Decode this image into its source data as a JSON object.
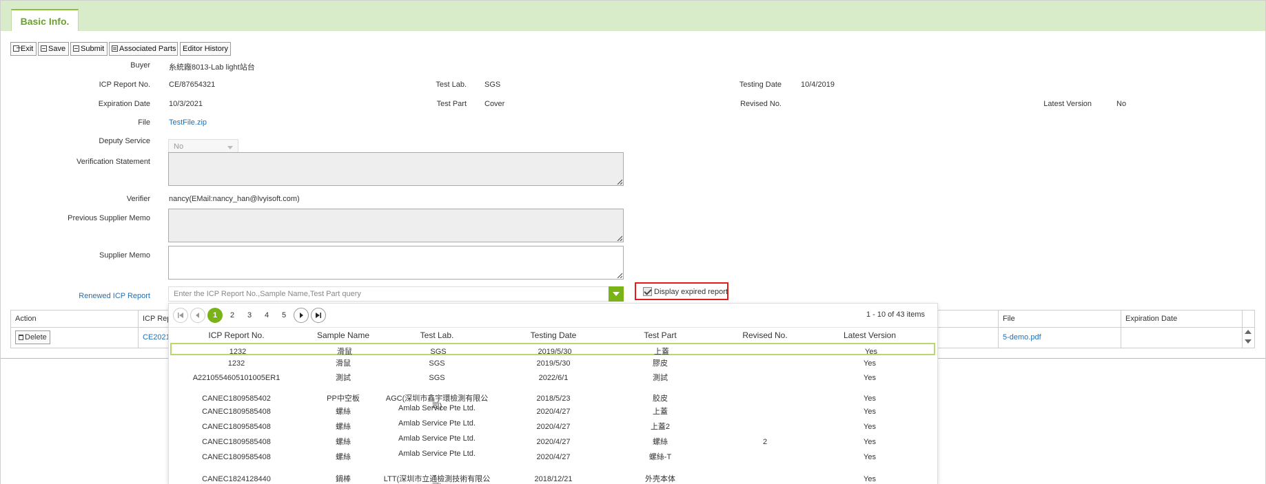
{
  "tab": {
    "label": "Basic Info."
  },
  "toolbar": {
    "exit": "Exit",
    "save": "Save",
    "submit": "Submit",
    "associated": "Associated Parts",
    "history": "Editor History"
  },
  "form": {
    "buyer_label": "Buyer",
    "buyer_value": "糸統廠8013-Lab light站台",
    "icp_label": "ICP Report No.",
    "icp_value": "CE/87654321",
    "testlab_label": "Test Lab.",
    "testlab_value": "SGS",
    "testdate_label": "Testing Date",
    "testdate_value": "10/4/2019",
    "expdate_label": "Expiration Date",
    "expdate_value": "10/3/2021",
    "testpart_label": "Test Part",
    "testpart_value": "Cover",
    "revised_label": "Revised No.",
    "latest_label": "Latest Version",
    "latest_value": "No",
    "file_label": "File",
    "file_value": "TestFile.zip",
    "deputy_label": "Deputy Service",
    "deputy_value": "No",
    "verification_label": "Verification Statement",
    "verifier_label": "Verifier",
    "verifier_value": "nancy(EMail:nancy_han@lvyisoft.com)",
    "prevmemo_label": "Previous Supplier Memo",
    "memo_label": "Supplier Memo",
    "renewed_label": "Renewed ICP Report",
    "renewed_placeholder": "Enter the ICP Report No.,Sample Name,Test Part query",
    "expired_label": "Display expired report"
  },
  "grid": {
    "headers": {
      "action": "Action",
      "icp": "ICP Rep",
      "file": "File",
      "expdate": "Expiration Date"
    },
    "row": {
      "delete": "Delete",
      "icp": "CE2021",
      "file": "5-demo.pdf"
    }
  },
  "popup": {
    "pages": [
      "1",
      "2",
      "3",
      "4",
      "5"
    ],
    "info": "1 - 10 of 43 items",
    "headers": [
      "ICP Report No.",
      "Sample Name",
      "Test Lab.",
      "Testing Date",
      "Test Part",
      "Revised No.",
      "Latest Version"
    ],
    "rows": [
      [
        "1232",
        "滑鼠",
        "SGS",
        "2019/5/30",
        "上蓋",
        "",
        "Yes"
      ],
      [
        "1232",
        "滑鼠",
        "SGS",
        "2019/5/30",
        "膠皮",
        "",
        "Yes"
      ],
      [
        "A2210554605101005ER1",
        "測試",
        "SGS",
        "2022/6/1",
        "測試",
        "",
        "Yes"
      ],
      [
        "CANEC1809585402",
        "PP中空板",
        "AGC(深圳市鑫宇環檢測有限公司)",
        "2018/5/23",
        "胶皮",
        "",
        "Yes"
      ],
      [
        "CANEC1809585408",
        "螺絲",
        "Amlab Service Pte Ltd.",
        "2020/4/27",
        "上蓋",
        "",
        "Yes"
      ],
      [
        "CANEC1809585408",
        "螺絲",
        "Amlab Service Pte Ltd.",
        "2020/4/27",
        "上蓋2",
        "",
        "Yes"
      ],
      [
        "CANEC1809585408",
        "螺絲",
        "Amlab Service Pte Ltd.",
        "2020/4/27",
        "螺絲",
        "2",
        "Yes"
      ],
      [
        "CANEC1809585408",
        "螺絲",
        "Amlab Service Pte Ltd.",
        "2020/4/27",
        "螺絲-T",
        "",
        "Yes"
      ],
      [
        "CANEC1824128440",
        "鍋棒",
        "LTT(深圳市立通檢測技術有限公司)",
        "2018/12/21",
        "外壳本体",
        "",
        "Yes"
      ]
    ]
  }
}
